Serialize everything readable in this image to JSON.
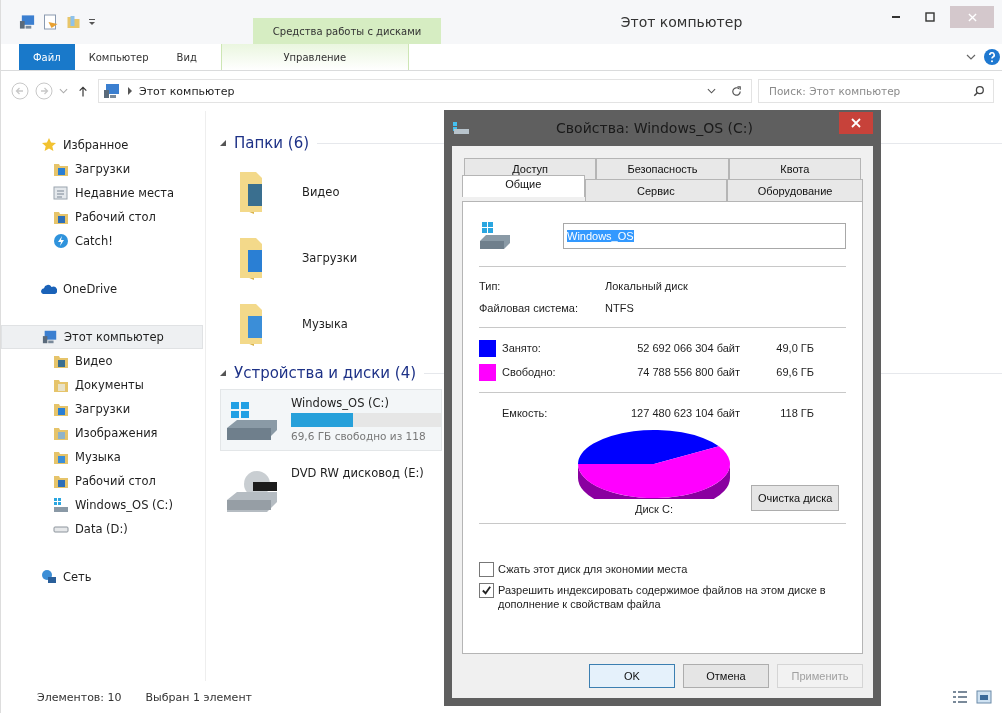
{
  "window": {
    "title": "Этот компьютер"
  },
  "contextual_group": "Средства работы с дисками",
  "ribbon_tabs": [
    {
      "label": "Файл",
      "kind": "file"
    },
    {
      "label": "Компьютер",
      "kind": "tab"
    },
    {
      "label": "Вид",
      "kind": "tab"
    },
    {
      "label": "Управление",
      "kind": "contextual"
    }
  ],
  "address": {
    "path": "Этот компьютер"
  },
  "search": {
    "placeholder": "Поиск: Этот компьютер"
  },
  "sidebar": {
    "items": [
      {
        "label": "Избранное",
        "kind": "star",
        "selected": false,
        "children": [
          {
            "label": "Загрузки",
            "kind": "downloads",
            "selected": false
          },
          {
            "label": "Недавние места",
            "kind": "recent",
            "selected": false
          },
          {
            "label": "Рабочий стол",
            "kind": "desktop",
            "selected": false
          },
          {
            "label": "Catch!",
            "kind": "catch",
            "selected": false
          }
        ]
      },
      {
        "label": "OneDrive",
        "kind": "cloud",
        "selected": false
      },
      {
        "label": "Этот компьютер",
        "kind": "computer",
        "selected": true,
        "children": [
          {
            "label": "Видео",
            "kind": "video",
            "selected": false
          },
          {
            "label": "Документы",
            "kind": "documents",
            "selected": false
          },
          {
            "label": "Загрузки",
            "kind": "downloads",
            "selected": false
          },
          {
            "label": "Изображения",
            "kind": "pictures",
            "selected": false
          },
          {
            "label": "Музыка",
            "kind": "music",
            "selected": false
          },
          {
            "label": "Рабочий стол",
            "kind": "desktop",
            "selected": false
          },
          {
            "label": "Windows_OS (C:)",
            "kind": "drive",
            "selected": false
          },
          {
            "label": "Data (D:)",
            "kind": "disk",
            "selected": false
          }
        ]
      },
      {
        "label": "Сеть",
        "kind": "network",
        "selected": false
      }
    ]
  },
  "folders": {
    "heading": "Папки (6)",
    "items": [
      {
        "label": "Видео",
        "kind": "video"
      },
      {
        "label": "Загрузки",
        "kind": "downloads"
      },
      {
        "label": "Музыка",
        "kind": "music"
      }
    ]
  },
  "devices": {
    "heading": "Устройства и диски (4)",
    "items": [
      {
        "label": "Windows_OS (C:)",
        "kind": "drive",
        "selected": true,
        "level": 0.41,
        "detail": "69,6 ГБ свободно из 118"
      },
      {
        "label": "DVD RW дисковод (E:)",
        "kind": "dvd",
        "selected": false
      }
    ]
  },
  "status_bar": {
    "count": "Элементов: 10",
    "selection": "Выбран 1 элемент"
  },
  "dialog": {
    "title": "Свойства: Windows_OS (C:)",
    "tab_rows": [
      [
        {
          "label": "Доступ",
          "selected": false
        },
        {
          "label": "Безопасность",
          "selected": false
        },
        {
          "label": "Квота",
          "selected": false
        }
      ],
      [
        {
          "label": "Общие",
          "selected": true
        },
        {
          "label": "Сервис",
          "selected": false
        },
        {
          "label": "Оборудование",
          "selected": false
        }
      ]
    ],
    "name_value": "Windows_OS",
    "info": [
      {
        "label": "Тип:",
        "value": "Локальный диск"
      },
      {
        "label": "Файловая система:",
        "value": "NTFS"
      }
    ],
    "usage": [
      {
        "label": "Занято:",
        "bytes": "52 692 066 304 байт",
        "size": "49,0 ГБ",
        "color": "#0000ff"
      },
      {
        "label": "Свободно:",
        "bytes": "74 788 556 800 байт",
        "size": "69,6 ГБ",
        "color": "#ff00ff"
      }
    ],
    "capacity": {
      "label": "Емкость:",
      "bytes": "127 480 623 104 байт",
      "size": "118 ГБ"
    },
    "disk_label": "Диск C:",
    "cleanup_button": "Очистка диска",
    "options": [
      {
        "label": "Сжать этот диск для экономии места",
        "checked": false
      },
      {
        "label": "Разрешить индексировать содержимое файлов на этом диске в дополнение к свойствам файла",
        "checked": true
      }
    ],
    "buttons": [
      {
        "label": "OK",
        "kind": "default",
        "disabled": false
      },
      {
        "label": "Отмена",
        "kind": "normal",
        "disabled": false
      },
      {
        "label": "Применить",
        "kind": "normal",
        "disabled": true
      }
    ]
  }
}
